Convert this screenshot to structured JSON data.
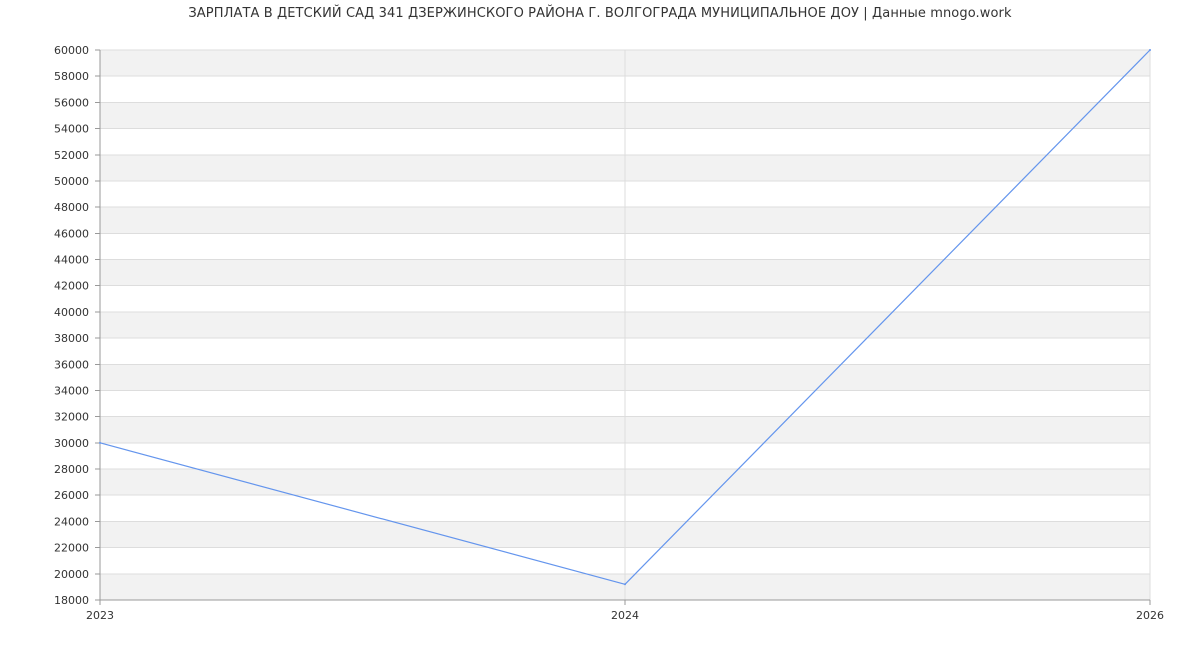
{
  "chart_data": {
    "type": "line",
    "title": "ЗАРПЛАТА В ДЕТСКИЙ САД 341 ДЗЕРЖИНСКОГО РАЙОНА Г. ВОЛГОГРАДА МУНИЦИПАЛЬНОЕ ДОУ | Данные mnogo.work",
    "xlabel": "",
    "ylabel": "",
    "x_ticks": [
      "2023",
      "2024",
      "2026"
    ],
    "y_ticks": [
      18000,
      20000,
      22000,
      24000,
      26000,
      28000,
      30000,
      32000,
      34000,
      36000,
      38000,
      40000,
      42000,
      44000,
      46000,
      48000,
      50000,
      52000,
      54000,
      56000,
      58000,
      60000
    ],
    "ylim": [
      18000,
      60000
    ],
    "grid": true,
    "series": [
      {
        "color": "#6495ed",
        "points": [
          {
            "x": "2023",
            "y": 30000
          },
          {
            "x": "2024",
            "y": 19200
          },
          {
            "x": "2026",
            "y": 60000
          }
        ]
      }
    ],
    "colors": {
      "band": "#f2f2f2",
      "grid": "#dddddd",
      "axis": "#999999"
    }
  }
}
